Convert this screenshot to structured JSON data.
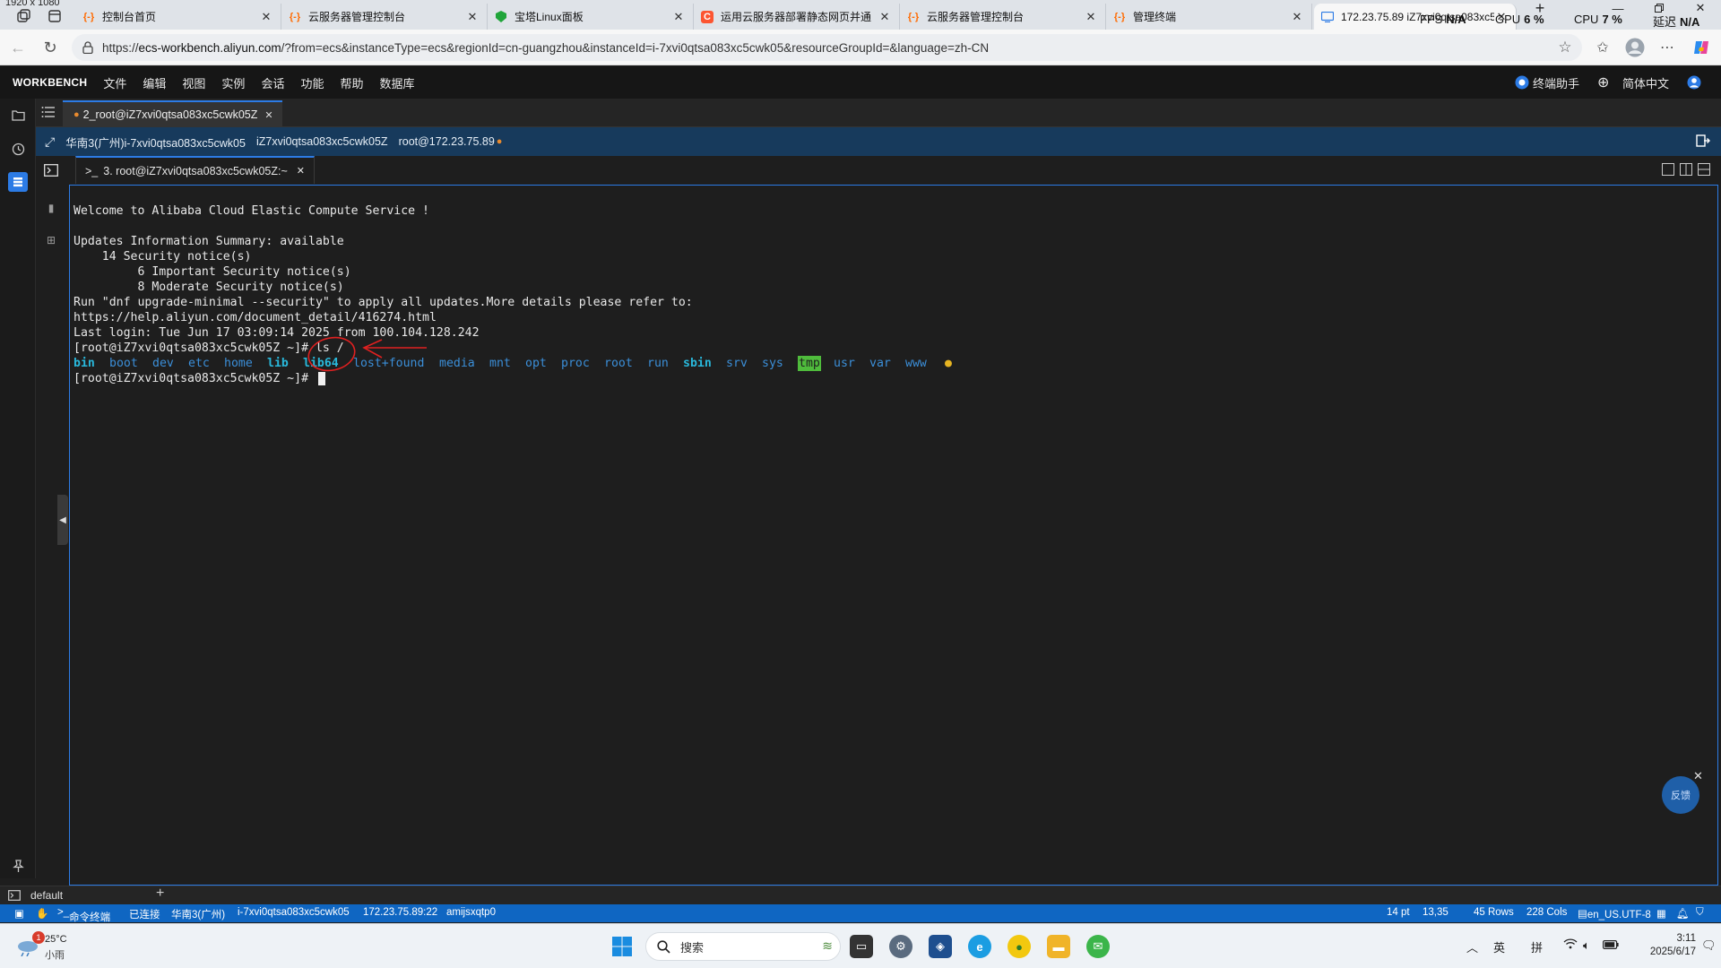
{
  "screen_label": "1920 x 1080",
  "browser": {
    "tabs": [
      {
        "title": "控制台首页",
        "favicon": "aliyun-icon",
        "color": "#ff6a00"
      },
      {
        "title": "云服务器管理控制台",
        "favicon": "aliyun-icon",
        "color": "#ff6a00"
      },
      {
        "title": "宝塔Linux面板",
        "favicon": "baota-icon",
        "color": "#20a53a"
      },
      {
        "title": "运用云服务器部署静态网页并通",
        "favicon": "csdn-icon",
        "color": "#fc5531"
      },
      {
        "title": "云服务器管理控制台",
        "favicon": "aliyun-icon",
        "color": "#ff6a00"
      },
      {
        "title": "管理终端",
        "favicon": "aliyun-icon",
        "color": "#ff6a00"
      },
      {
        "title": "172.23.75.89 iZ7xvi0qtsa083xc5",
        "favicon": "workbench-icon",
        "color": "#2c7be5"
      }
    ],
    "overlay": {
      "fps_label": "FPS",
      "fps_value": "N/A",
      "gpu_label": "GPU",
      "gpu_value": "6 %",
      "cpu_label": "CPU",
      "cpu_value": "7 %",
      "latency_label": "延迟",
      "latency_value": "N/A"
    },
    "url_prefix": "https://",
    "url_host": "ecs-workbench.aliyun.com",
    "url_rest": "/?from=ecs&instanceType=ecs&regionId=cn-guangzhou&instanceId=i-7xvi0qtsa083xc5cwk05&resourceGroupId=&language=zh-CN"
  },
  "menubar": {
    "brand": "WORKBENCH",
    "items": [
      "文件",
      "编辑",
      "视图",
      "实例",
      "会话",
      "功能",
      "帮助",
      "数据库"
    ],
    "assistant": "终端助手",
    "language": "简体中文"
  },
  "session_tab": "2_root@iZ7xvi0qtsa083xc5cwk05Z",
  "infobar": {
    "region_instance": "华南3(广州)i-7xvi0qtsa083xc5cwk05",
    "hostname": "iZ7xvi0qtsa083xc5cwk05Z",
    "user_host": "root@172.23.75.89"
  },
  "terminal_tab": "3. root@iZ7xvi0qtsa083xc5cwk05Z:~",
  "terminal": {
    "welcome": "Welcome to Alibaba Cloud Elastic Compute Service !",
    "updates_summary": "Updates Information Summary: available",
    "security_notices": "    14 Security notice(s)",
    "important_notices": "         6 Important Security notice(s)",
    "moderate_notices": "         8 Moderate Security notice(s)",
    "run_hint": "Run \"dnf upgrade-minimal --security\" to apply all updates.More details please refer to:",
    "help_url": "https://help.aliyun.com/document_detail/416274.html",
    "last_login": "Last login: Tue Jun 17 03:09:14 2025 from 100.104.128.242",
    "prompt": "[root@iZ7xvi0qtsa083xc5cwk05Z ~]# ",
    "command": "ls /",
    "dirs": [
      "bin",
      "boot",
      "dev",
      "etc",
      "home",
      "lib",
      "lib64",
      "lost+found",
      "media",
      "mnt",
      "opt",
      "proc",
      "root",
      "run",
      "sbin",
      "srv",
      "sys",
      "tmp",
      "usr",
      "var",
      "www"
    ],
    "prompt2": "[root@iZ7xvi0qtsa083xc5cwk05Z ~]# "
  },
  "feedback_label": "反馈",
  "panel": {
    "tab": "default"
  },
  "statusbar": {
    "mode": "命令终端",
    "state": "已连接",
    "region": "华南3(广州)",
    "instance": "i-7xvi0qtsa083xc5cwk05",
    "address": "172.23.75.89:22",
    "session_id": "amijsxqtp0",
    "font_size": "14 pt",
    "cursor_pos": "13,35",
    "rows": "45 Rows",
    "cols": "228 Cols",
    "locale": "en_US.UTF-8"
  },
  "taskbar": {
    "weather_temp": "25°C",
    "weather_desc": "小雨",
    "weather_badge": "1",
    "search_placeholder": "搜索",
    "ime_lang": "英",
    "ime_mode": "拼",
    "time": "3:11",
    "date": "2025/6/17"
  }
}
